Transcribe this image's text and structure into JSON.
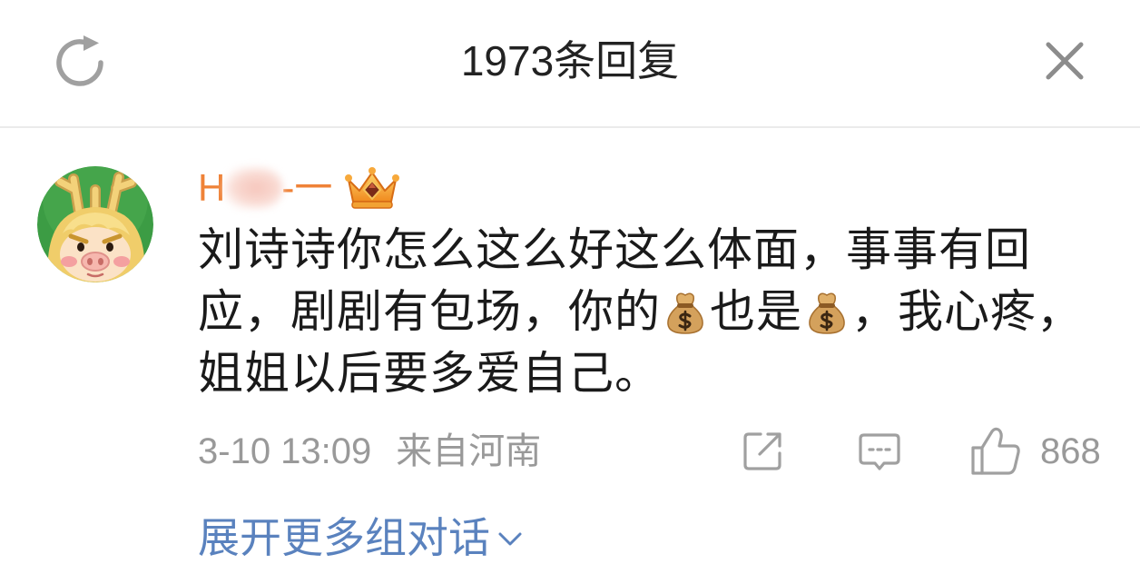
{
  "header": {
    "title": "1973条回复",
    "refresh_icon": "refresh-icon",
    "close_icon": "close-icon"
  },
  "comment": {
    "avatar": "cartoon-avatar",
    "username_start": "H",
    "username_end": "-一",
    "badge_icon": "vip-crown-icon",
    "text_parts": [
      "刘诗诗你怎么这么好这么体面，事事有回",
      "应，剧剧有包场，你的",
      "也是",
      "，我心疼，",
      "姐姐以后要多爱自己。"
    ],
    "inline_icon": "money-bag-icon",
    "time": "3-10 13:09",
    "location": "来自河南",
    "actions": {
      "forward_icon": "forward-icon",
      "reply_icon": "comment-icon",
      "like_icon": "like-icon",
      "like_count": "868"
    }
  },
  "expand_link": {
    "label": "展开更多组对话",
    "icon": "chevron-down-icon"
  },
  "colors": {
    "username": "#ef8237",
    "link": "#5a82be",
    "text": "#1a1a1a",
    "title": "#222222",
    "meta": "#999999",
    "icon": "#a0a0a0",
    "divider": "#ebebeb",
    "avatar_bg": "#3c9c44"
  }
}
